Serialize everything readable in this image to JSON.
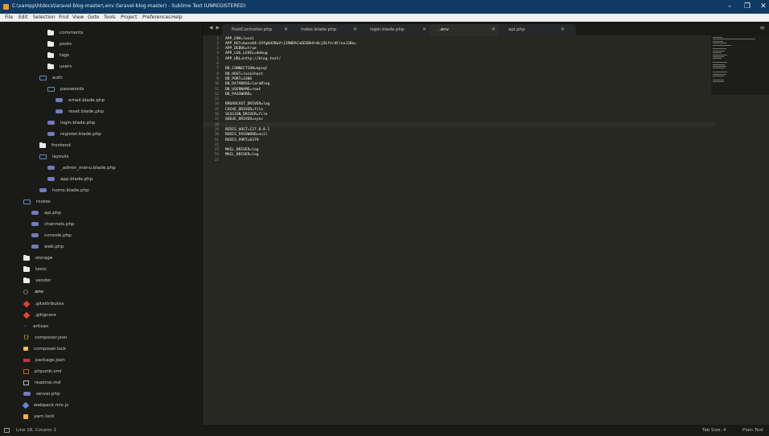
{
  "window": {
    "title": "C:\\xampp\\htdocs\\laravel-blog-master\\.env (laravel-blog-master) - Sublime Text (UNREGISTERED)",
    "controls": {
      "minimize": "–",
      "maximize": "❐",
      "close": "✕"
    }
  },
  "menu": [
    "File",
    "Edit",
    "Selection",
    "Find",
    "View",
    "Goto",
    "Tools",
    "Project",
    "Preferences",
    "Help"
  ],
  "sidebar": {
    "items": [
      {
        "label": "comments",
        "icon": "folder-icon"
      },
      {
        "label": "posts",
        "icon": "folder-icon"
      },
      {
        "label": "tags",
        "icon": "folder-icon"
      },
      {
        "label": "users",
        "icon": "folder-icon"
      },
      {
        "label": "auth",
        "icon": "folder-open-icon"
      },
      {
        "label": "passwords",
        "icon": "folder-open-icon"
      },
      {
        "label": "email.blade.php",
        "icon": "blade-file-icon"
      },
      {
        "label": "reset.blade.php",
        "icon": "blade-file-icon"
      },
      {
        "label": "login.blade.php",
        "icon": "blade-file-icon"
      },
      {
        "label": "register.blade.php",
        "icon": "blade-file-icon"
      },
      {
        "label": "frontend",
        "icon": "folder-icon"
      },
      {
        "label": "layouts",
        "icon": "folder-open-icon"
      },
      {
        "label": "_admin_menu.blade.php",
        "icon": "blade-file-icon"
      },
      {
        "label": "app.blade.php",
        "icon": "blade-file-icon"
      },
      {
        "label": "home.blade.php",
        "icon": "blade-file-icon"
      },
      {
        "label": "routes",
        "icon": "folder-open-icon"
      },
      {
        "label": "api.php",
        "icon": "php-file-icon"
      },
      {
        "label": "channels.php",
        "icon": "php-file-icon"
      },
      {
        "label": "console.php",
        "icon": "php-file-icon"
      },
      {
        "label": "web.php",
        "icon": "php-file-icon"
      },
      {
        "label": "storage",
        "icon": "folder-icon"
      },
      {
        "label": "tests",
        "icon": "folder-icon"
      },
      {
        "label": "vendor",
        "icon": "folder-icon"
      },
      {
        "label": ".env",
        "icon": "env-file-icon"
      },
      {
        "label": ".gitattributes",
        "icon": "git-icon"
      },
      {
        "label": ".gitignore",
        "icon": "git-icon"
      },
      {
        "label": "artisan",
        "icon": "artisan-icon"
      },
      {
        "label": "composer.json",
        "icon": "json-icon"
      },
      {
        "label": "composer.lock",
        "icon": "lock-icon"
      },
      {
        "label": "package.json",
        "icon": "npm-icon"
      },
      {
        "label": "phpunit.xml",
        "icon": "xml-icon"
      },
      {
        "label": "readme.md",
        "icon": "markdown-icon"
      },
      {
        "label": "server.php",
        "icon": "php-file-icon"
      },
      {
        "label": "webpack.mix.js",
        "icon": "webpack-icon"
      },
      {
        "label": "yarn.lock",
        "icon": "yarn-icon"
      }
    ]
  },
  "tabs": {
    "nav": "◀ ▶",
    "items": [
      {
        "label": "PostController.php",
        "close": "✕"
      },
      {
        "label": "index.blade.php",
        "close": "✕"
      },
      {
        "label": "login.blade.php",
        "close": "✕"
      },
      {
        "label": ".env",
        "close": "✕"
      },
      {
        "label": "api.php",
        "close": "✕"
      }
    ],
    "active": ".env",
    "menu_glyph": "≡"
  },
  "editor": {
    "lines": [
      "APP_ENV=local",
      "APP_KEY=base64:CHfgHd2NuVrjIRWDACa6EGDkA+0cjDLferdF/oxJ28o=",
      "APP_DEBUG=true",
      "APP_LOG_LEVEL=debug",
      "APP_URL=http://blog.test/",
      "",
      "DB_CONNECTION=mysql",
      "DB_HOST=localhost",
      "DB_PORT=3306",
      "DB_DATABASE=laraBlog",
      "DB_USERNAME=root",
      "DB_PASSWORD=",
      "",
      "BROADCAST_DRIVER=log",
      "CACHE_DRIVER=file",
      "SESSION_DRIVER=file",
      "QUEUE_DRIVER=sync",
      "",
      "REDIS_HOST=127.0.0.1",
      "REDIS_PASSWORD=null",
      "REDIS_PORT=6379",
      "",
      "MAIL_DRIVER=log",
      "MAIL_DRIVER=log",
      ""
    ],
    "current_line": 18
  },
  "status": {
    "cursor": "Line 18, Column 1",
    "tab_size": "Tab Size: 4",
    "syntax": "Plain Text"
  },
  "colors": {
    "titlebar": "#0f3a63",
    "sidebar": "#1a1b17",
    "editor": "#272822",
    "statusbar": "#191a16"
  }
}
